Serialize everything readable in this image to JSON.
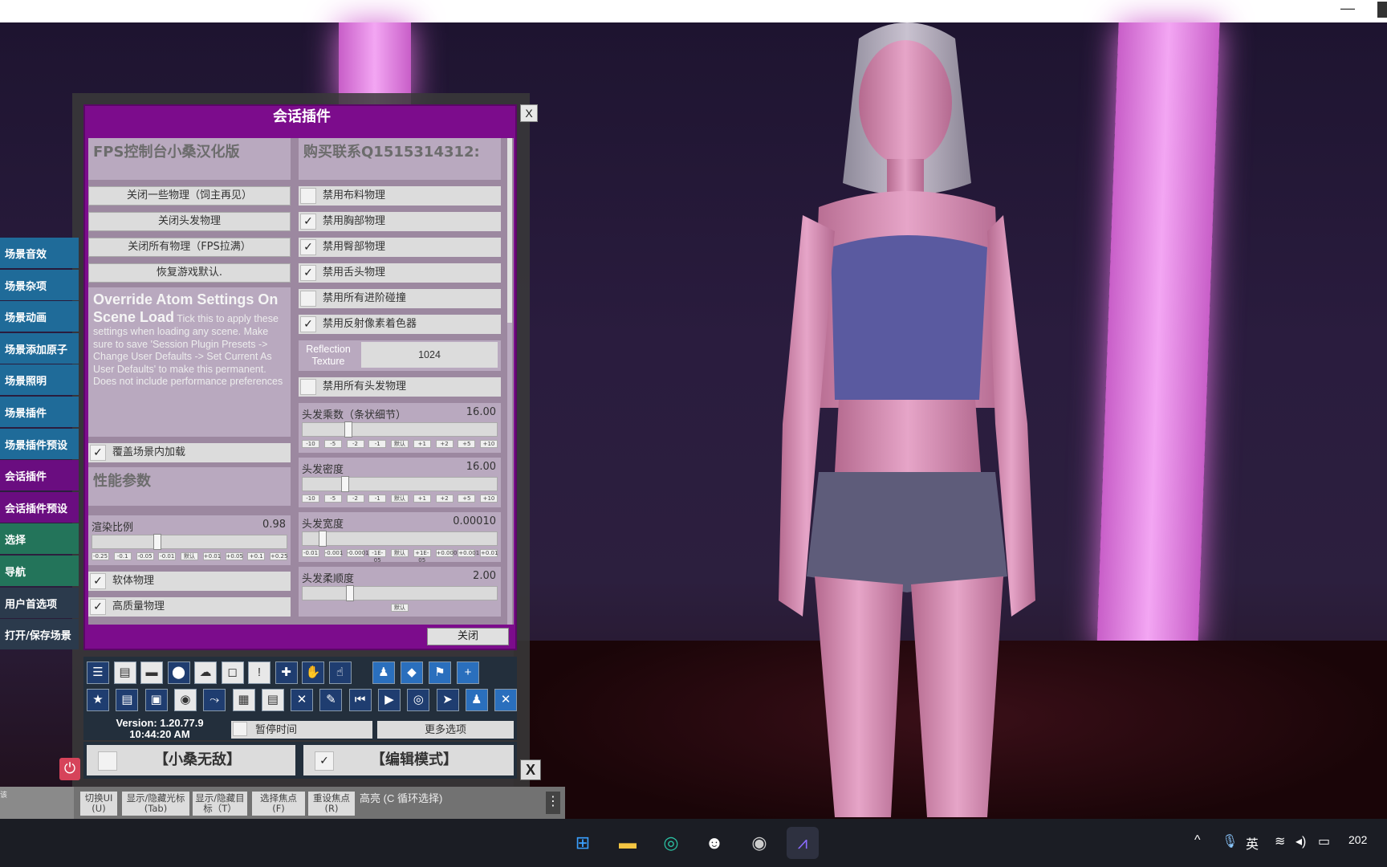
{
  "window": {
    "minimize_glyph": "—"
  },
  "sidenav": [
    {
      "label": "场景音效",
      "style": "blue"
    },
    {
      "label": "场景杂项",
      "style": "blue"
    },
    {
      "label": "场景动画",
      "style": "blue"
    },
    {
      "label": "场景添加原子",
      "style": "blue"
    },
    {
      "label": "场景照明",
      "style": "blue"
    },
    {
      "label": "场景插件",
      "style": "blue"
    },
    {
      "label": "场景插件预设",
      "style": "blue"
    },
    {
      "label": "会话插件",
      "style": "purple"
    },
    {
      "label": "会话插件预设",
      "style": "purple"
    },
    {
      "label": "选择",
      "style": "green"
    },
    {
      "label": "导航",
      "style": "green"
    },
    {
      "label": "用户首选项",
      "style": "dark"
    },
    {
      "label": "打开/保存场景",
      "style": "dark"
    }
  ],
  "dialog": {
    "title": "会话插件",
    "close_x": "X",
    "left": {
      "header": "FPS控制台小桑汉化版",
      "buttons": [
        "关闭一些物理（饲主再见）",
        "关闭头发物理",
        "关闭所有物理（FPS拉满）",
        "恢复游戏默认."
      ],
      "override_title": "Override Atom Settings On Scene Load",
      "override_desc": "Tick this to apply these settings when loading any scene. Make sure to save 'Session Plugin Presets -> Change User Defaults -> Set Current As User Defaults' to make this permanent. Does not include performance preferences",
      "override_check": {
        "label": "覆盖场景内加载",
        "checked": true
      },
      "perf_header": "性能参数",
      "render_scale": {
        "label": "渲染比例",
        "value": "0.98",
        "steps": [
          "-0.25",
          "-0.1",
          "-0.05",
          "-0.01",
          "默认",
          "+0.01",
          "+0.05",
          "+0.1",
          "+0.25"
        ]
      },
      "soft_physics": {
        "label": "软体物理",
        "checked": true
      },
      "hq_physics": {
        "label": "高质量物理",
        "checked": true
      }
    },
    "right": {
      "header": "购买联系Q1515314312:",
      "checks": [
        {
          "label": "禁用布料物理",
          "checked": false
        },
        {
          "label": "禁用胸部物理",
          "checked": true
        },
        {
          "label": "禁用臀部物理",
          "checked": true
        },
        {
          "label": "禁用舌头物理",
          "checked": true
        },
        {
          "label": "禁用所有进阶碰撞",
          "checked": false
        },
        {
          "label": "禁用反射像素着色器",
          "checked": true
        }
      ],
      "reflection": {
        "label": "Reflection Texture",
        "value": "1024"
      },
      "hair_all": {
        "label": "禁用所有头发物理",
        "checked": false
      },
      "sliders": [
        {
          "label": "头发乘数（条状细节）",
          "value": "16.00",
          "steps": [
            "-10",
            "-5",
            "-2",
            "-1",
            "默认",
            "+1",
            "+2",
            "+5",
            "+10"
          ]
        },
        {
          "label": "头发密度",
          "value": "16.00",
          "steps": [
            "-10",
            "-5",
            "-2",
            "-1",
            "默认",
            "+1",
            "+2",
            "+5",
            "+10"
          ]
        },
        {
          "label": "头发宽度",
          "value": "0.00010",
          "steps": [
            "-0.01",
            "-0.001",
            "-0.0001",
            "-1E-05",
            "默认",
            "+1E-05",
            "+0.0001",
            "+0.001",
            "+0.01"
          ]
        },
        {
          "label": "头发柔顺度",
          "value": "2.00",
          "steps": [
            "默认"
          ]
        }
      ]
    },
    "close_label": "关闭"
  },
  "toolbar": {
    "row1": [
      "menu-icon",
      "open-scene-icon",
      "folder-icon",
      "save-red-icon",
      "cloud-icon",
      "cube-icon",
      "alert-icon",
      "add-person-icon",
      "hand-icon",
      "hand-point-icon",
      "person-icon",
      "unity-icon",
      "flag-icon",
      "plus-icon"
    ],
    "row2": [
      "star-icon",
      "open-scene2-icon",
      "folder-cam-icon",
      "camera-icon",
      "nodes-icon",
      "layers-icon",
      "document-icon",
      "person-remove-icon",
      "wrench-hand-icon",
      "skip-back-icon",
      "play-icon",
      "target-icon",
      "cursor-icon",
      "people-icon",
      "tools-icon"
    ],
    "glyphs1": [
      "☰",
      "▤",
      "▬",
      "⬤",
      "☁",
      "◻",
      "!",
      "✚",
      "✋",
      "☝",
      "♟",
      "◆",
      "⚑",
      "+"
    ],
    "glyphs2": [
      "★",
      "▤",
      "▣",
      "◉",
      "⤳",
      "▦",
      "▤",
      "✕",
      "✎",
      "⏮",
      "▶",
      "◎",
      "➤",
      "♟",
      "✕"
    ]
  },
  "version": {
    "line1": "Version: 1.20.77.9",
    "line2": "10:44:20 AM"
  },
  "pause": {
    "label": "暂停时间",
    "checked": false
  },
  "more_options": "更多选项",
  "modes": [
    {
      "label": "【小桑无敌】",
      "checked": false
    },
    {
      "label": "【编辑模式】",
      "checked": true
    }
  ],
  "mode_close": "X",
  "hints": [
    {
      "label": "切换UI\n(U)"
    },
    {
      "label": "显示/隐藏光标\n(Tab)"
    },
    {
      "label": "显示/隐藏目\n标（T）"
    },
    {
      "label": "选择焦点\n(F)"
    },
    {
      "label": "重设焦点\n(R)"
    }
  ],
  "hint_left": "该",
  "hint_text": "高亮 (C 循环选择)",
  "taskbar": {
    "apps": [
      "windows-start-icon",
      "file-explorer-icon",
      "edge-icon",
      "qq-icon",
      "obs-icon",
      "vam-icon"
    ],
    "tray": {
      "chevron": "^",
      "mic": "🎙",
      "ime": "英",
      "clock": "202"
    }
  }
}
